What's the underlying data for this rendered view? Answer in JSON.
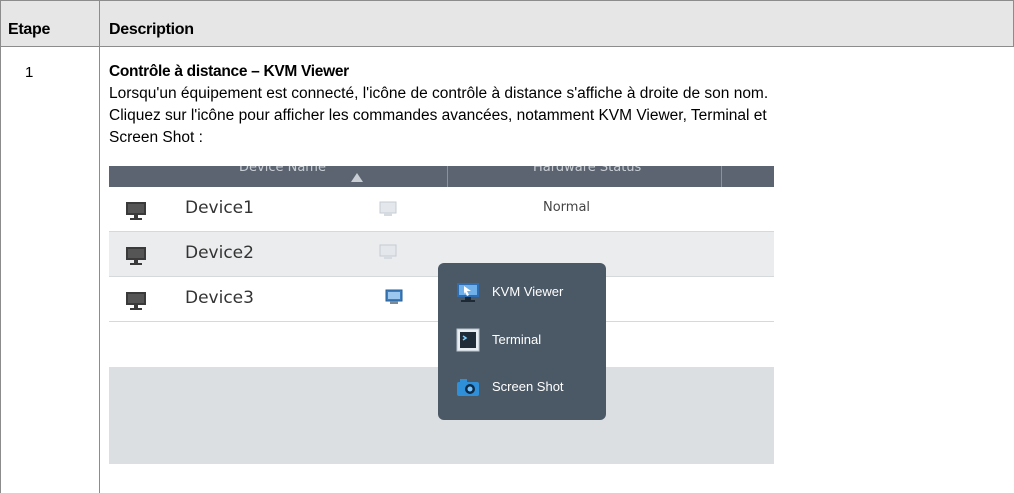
{
  "table": {
    "header": {
      "step": "Etape",
      "description": "Description"
    },
    "rows": [
      {
        "step": "1",
        "title": "Contrôle à distance – KVM Viewer",
        "line1": "Lorsqu'un équipement est connecté, l'icône de contrôle à distance s'affiche à droite de son nom.",
        "line2": "Cliquez sur l'icône pour afficher les commandes avancées, notamment KVM Viewer, Terminal et",
        "line3": "Screen Shot :"
      }
    ]
  },
  "screenshot": {
    "columns": {
      "device_name": "Device Name",
      "hardware_status": "Hardware Status"
    },
    "devices": [
      {
        "name": "Device1",
        "status": "Normal"
      },
      {
        "name": "Device2",
        "status": ""
      },
      {
        "name": "Device3",
        "status": ""
      }
    ],
    "menu": [
      {
        "label": "KVM Viewer",
        "icon": "kvm-viewer-icon"
      },
      {
        "label": "Terminal",
        "icon": "terminal-icon"
      },
      {
        "label": "Screen Shot",
        "icon": "camera-icon"
      }
    ]
  }
}
